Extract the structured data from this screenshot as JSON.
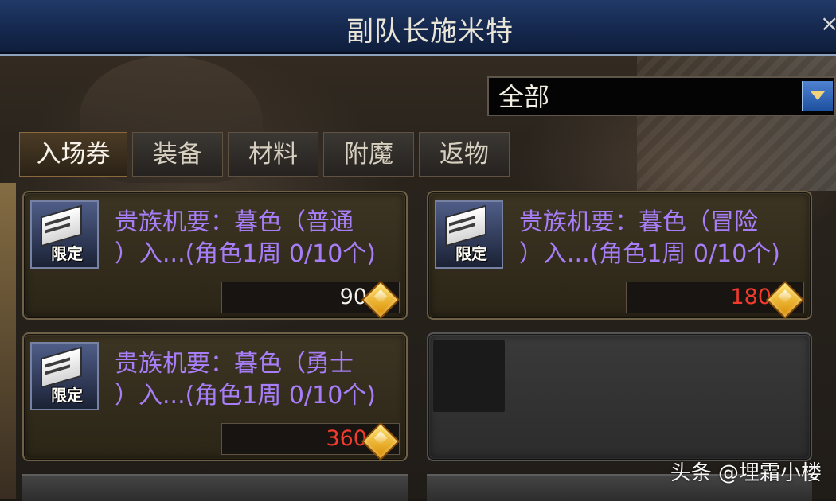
{
  "window": {
    "title": "副队长施米特",
    "close": "×"
  },
  "filter": {
    "selected": "全部"
  },
  "tabs": [
    {
      "label": "入场券",
      "active": true
    },
    {
      "label": "装备",
      "active": false
    },
    {
      "label": "材料",
      "active": false
    },
    {
      "label": "附魔",
      "active": false
    },
    {
      "label": "返物",
      "active": false
    }
  ],
  "items": [
    {
      "name": "贵族机要：暮色（普通\n）入...(角色1周 0/10个)",
      "badge": "限定",
      "price": "90",
      "price_color": "#f4f0ea",
      "currency_icon": "gold-gem-icon"
    },
    {
      "name": "贵族机要：暮色（冒险\n）入...(角色1周 0/10个)",
      "badge": "限定",
      "price": "180",
      "price_color": "#f23b2d",
      "currency_icon": "gold-gem-icon"
    },
    {
      "name": "贵族机要：暮色（勇士\n）入...(角色1周 0/10个)",
      "badge": "限定",
      "price": "360",
      "price_color": "#f23b2d",
      "currency_icon": "gold-gem-icon"
    }
  ],
  "watermark": "头条 @埋霜小楼",
  "colors": {
    "title_bar": "#14264b",
    "item_name": "#a77ef8",
    "accent_gold": "#f2c34b"
  }
}
